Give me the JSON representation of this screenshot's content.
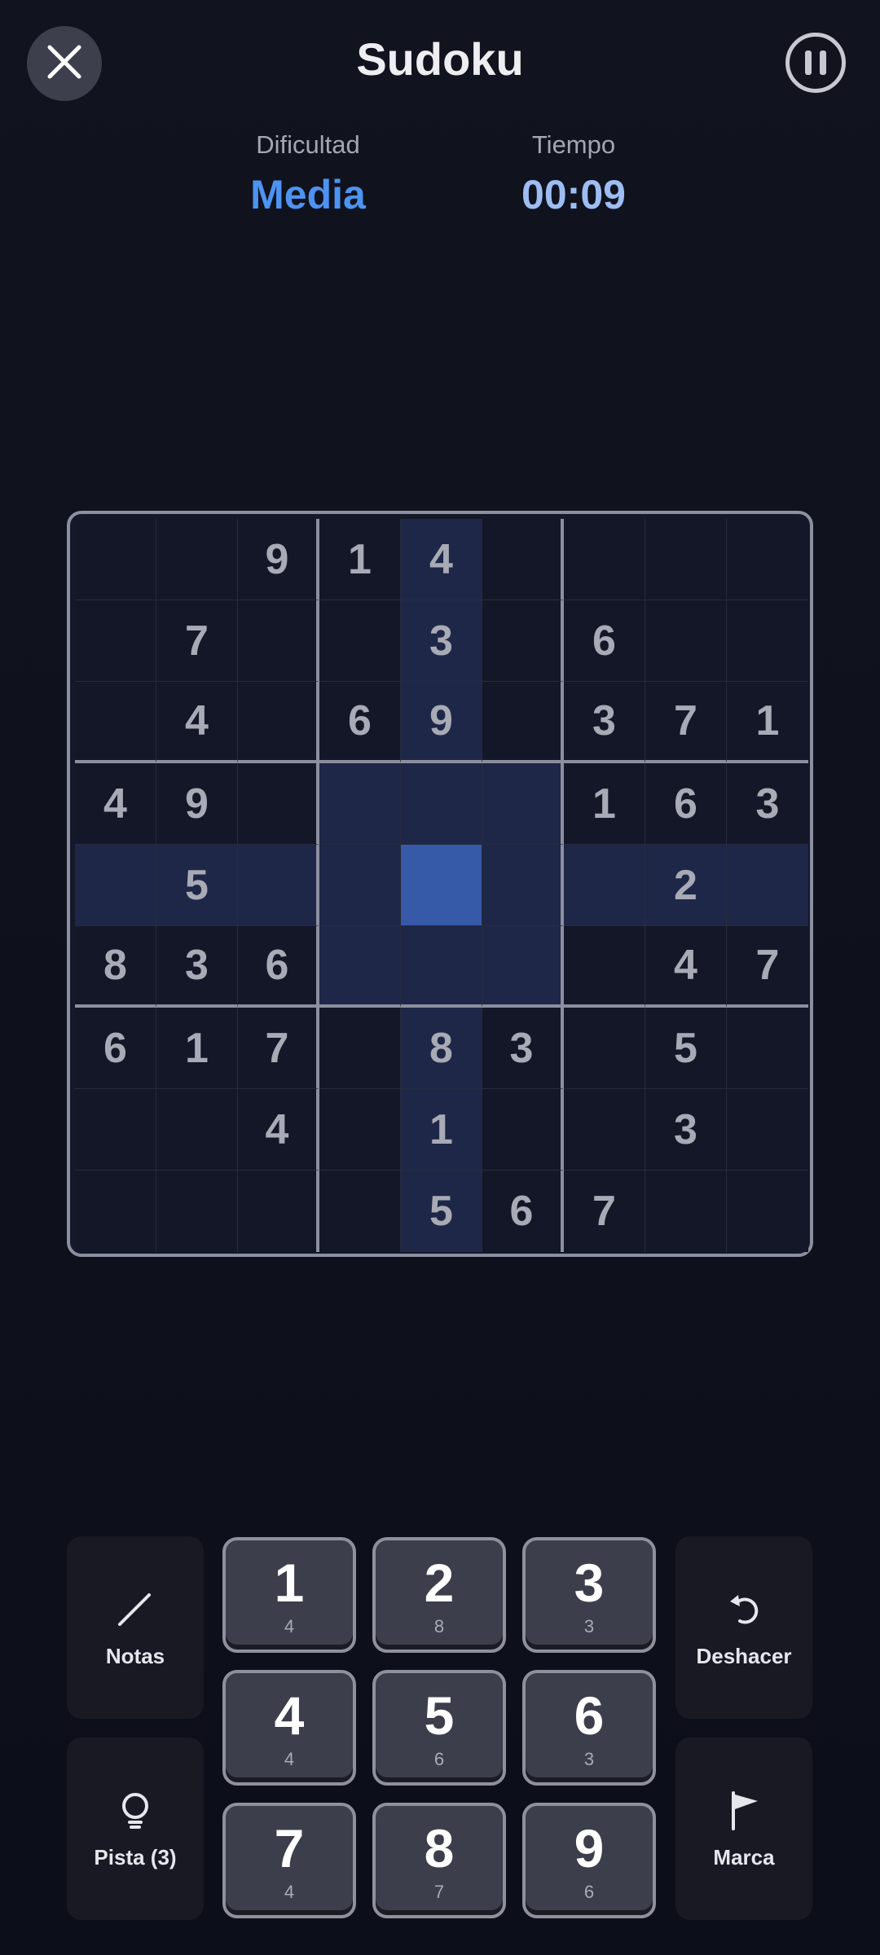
{
  "header": {
    "title": "Sudoku",
    "difficulty_label": "Dificultad",
    "difficulty_value": "Media",
    "time_label": "Tiempo",
    "time_value": "00:09"
  },
  "board": {
    "grid": [
      [
        "",
        "",
        "9",
        "1",
        "4",
        "",
        "",
        "",
        ""
      ],
      [
        "",
        "7",
        "",
        "",
        "3",
        "",
        "6",
        "",
        ""
      ],
      [
        "",
        "4",
        "",
        "6",
        "9",
        "",
        "3",
        "7",
        "1"
      ],
      [
        "4",
        "9",
        "",
        "",
        "",
        "",
        "1",
        "6",
        "3"
      ],
      [
        "",
        "5",
        "",
        "",
        "",
        "",
        "",
        "2",
        ""
      ],
      [
        "8",
        "3",
        "6",
        "",
        "",
        "",
        "",
        "4",
        "7"
      ],
      [
        "6",
        "1",
        "7",
        "",
        "8",
        "3",
        "",
        "5",
        ""
      ],
      [
        "",
        "",
        "4",
        "",
        "1",
        "",
        "",
        "3",
        ""
      ],
      [
        "",
        "",
        "",
        "",
        "5",
        "6",
        "7",
        "",
        ""
      ]
    ],
    "selected_cell": {
      "row": 5,
      "col": 5
    }
  },
  "controls": {
    "notes_label": "Notas",
    "hint_label": "Pista (3)",
    "undo_label": "Deshacer",
    "flag_label": "Marca",
    "numbers": [
      {
        "digit": "1",
        "remaining": "4"
      },
      {
        "digit": "2",
        "remaining": "8"
      },
      {
        "digit": "3",
        "remaining": "3"
      },
      {
        "digit": "4",
        "remaining": "4"
      },
      {
        "digit": "5",
        "remaining": "6"
      },
      {
        "digit": "6",
        "remaining": "3"
      },
      {
        "digit": "7",
        "remaining": "4"
      },
      {
        "digit": "8",
        "remaining": "7"
      },
      {
        "digit": "9",
        "remaining": "6"
      }
    ]
  },
  "icons": {
    "close": "close-icon",
    "pause": "pause-icon",
    "notes": "pencil-icon",
    "hint": "lightbulb-icon",
    "undo": "undo-icon",
    "flag": "flag-icon"
  },
  "colors": {
    "accent": "#4d93f1",
    "selected_cell": "#3659a8",
    "highlight": "#1f2748"
  }
}
